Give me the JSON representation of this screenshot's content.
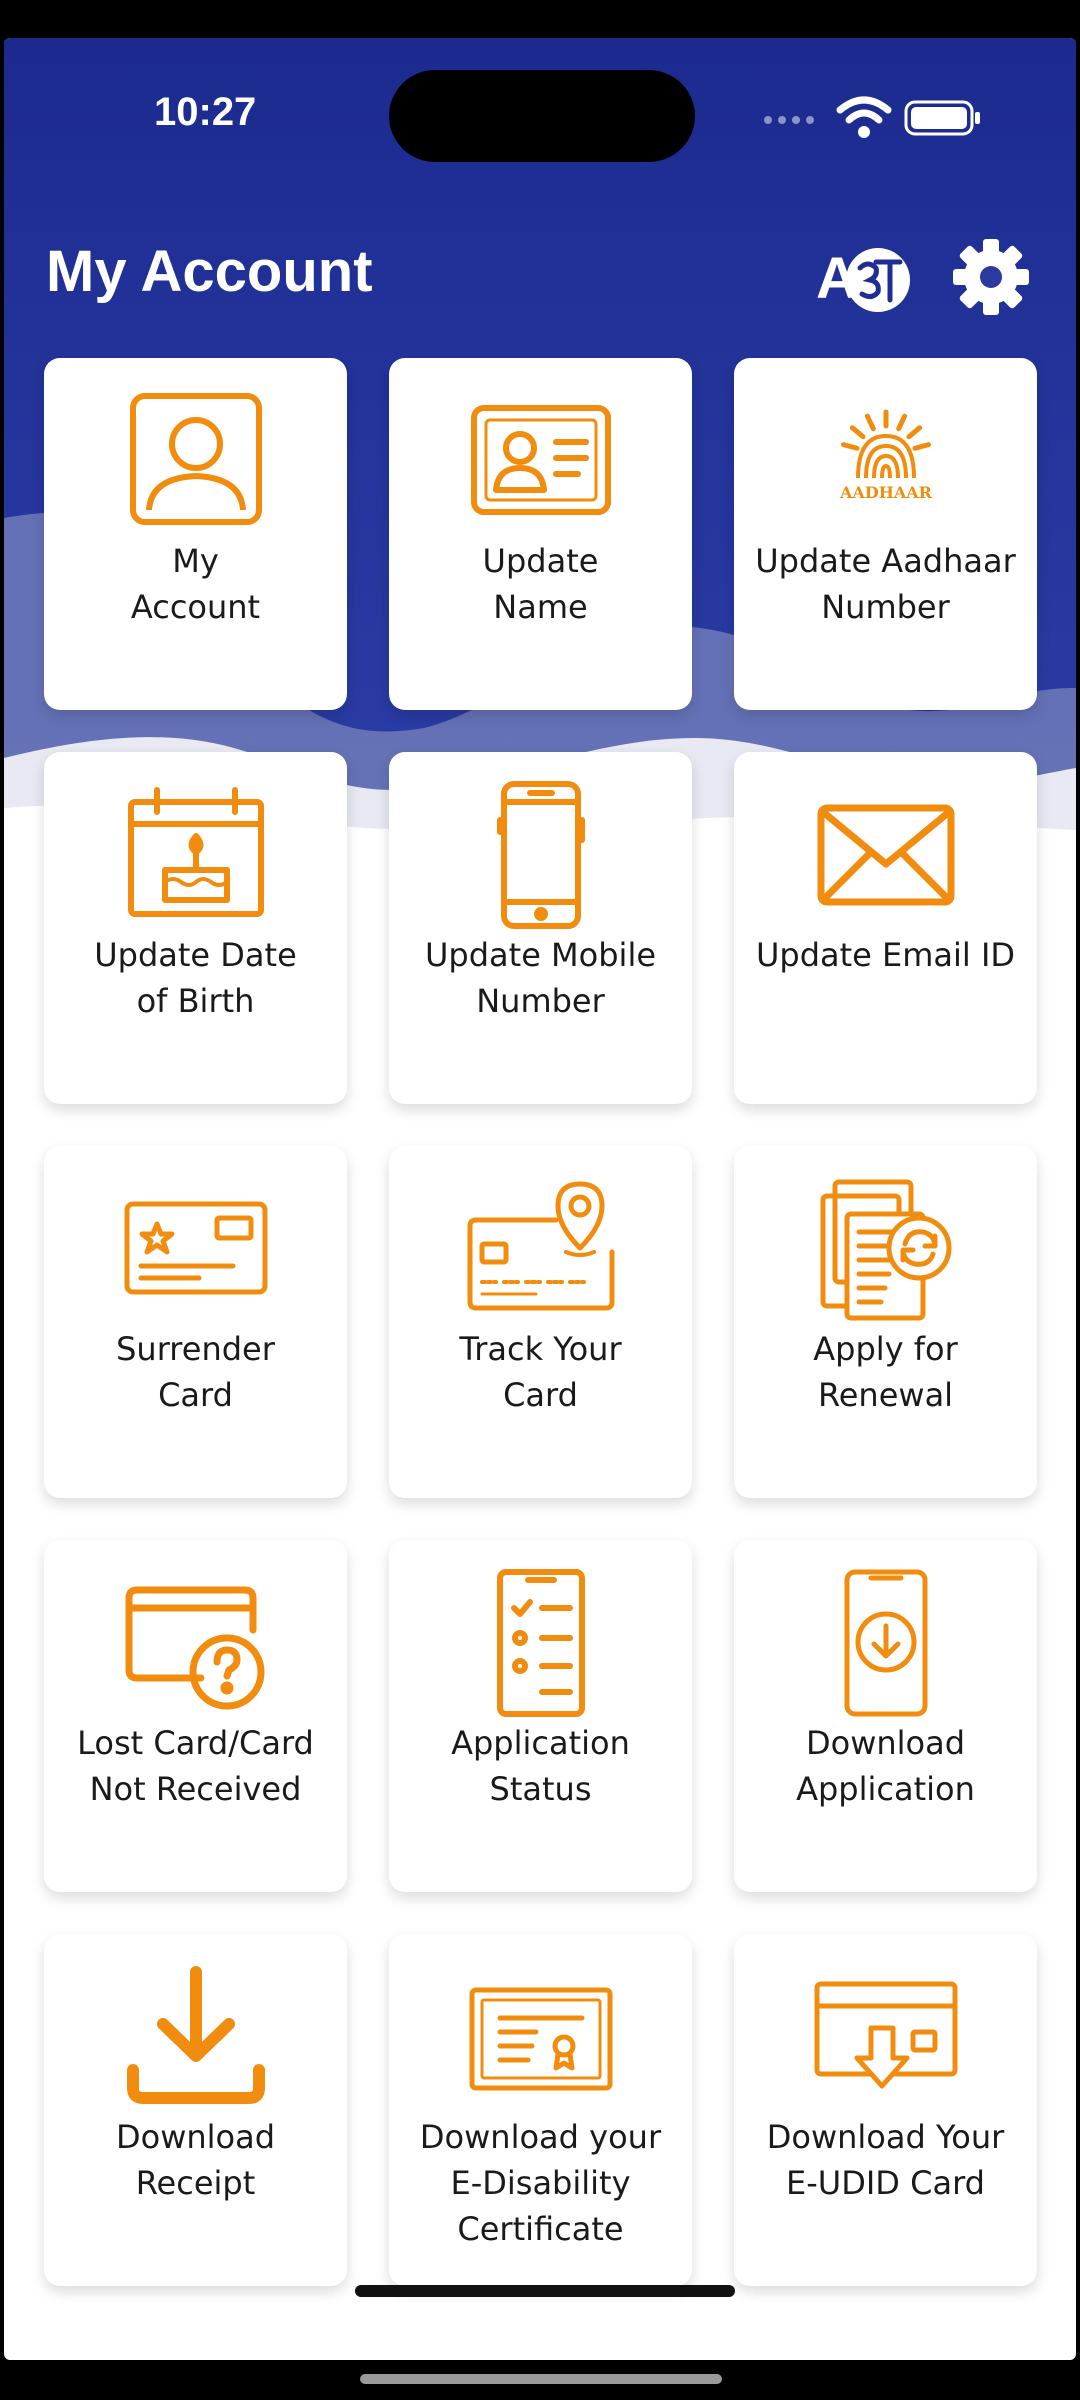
{
  "status_bar": {
    "time": "10:27"
  },
  "header": {
    "title": "My Account"
  },
  "tiles": [
    {
      "label": "My\nAccount",
      "icon": "user-profile-icon"
    },
    {
      "label": "Update\nName",
      "icon": "id-card-icon"
    },
    {
      "label": "Update Aadhaar\nNumber",
      "icon": "aadhaar-logo-icon",
      "logo_text": "AADHAAR"
    },
    {
      "label": "Update Date\nof Birth",
      "icon": "birthday-calendar-icon"
    },
    {
      "label": "Update Mobile\nNumber",
      "icon": "mobile-phone-icon"
    },
    {
      "label": "Update Email ID",
      "icon": "envelope-icon"
    },
    {
      "label": "Surrender\nCard",
      "icon": "card-star-icon"
    },
    {
      "label": "Track Your\nCard",
      "icon": "card-location-icon"
    },
    {
      "label": "Apply for\nRenewal",
      "icon": "document-renew-icon"
    },
    {
      "label": "Lost Card/Card\nNot Received",
      "icon": "card-question-icon"
    },
    {
      "label": "Application\nStatus",
      "icon": "checklist-icon"
    },
    {
      "label": "Download\nApplication",
      "icon": "phone-download-icon"
    },
    {
      "label": "Download\nReceipt",
      "icon": "download-tray-icon"
    },
    {
      "label": "Download your\nE-Disability\nCertificate",
      "icon": "certificate-icon"
    },
    {
      "label": "Download Your\nE-UDID Card",
      "icon": "card-download-icon"
    }
  ],
  "colors": {
    "accent": "#f28c0f",
    "header": "#1f2e94",
    "text": "#1a1a1a"
  }
}
